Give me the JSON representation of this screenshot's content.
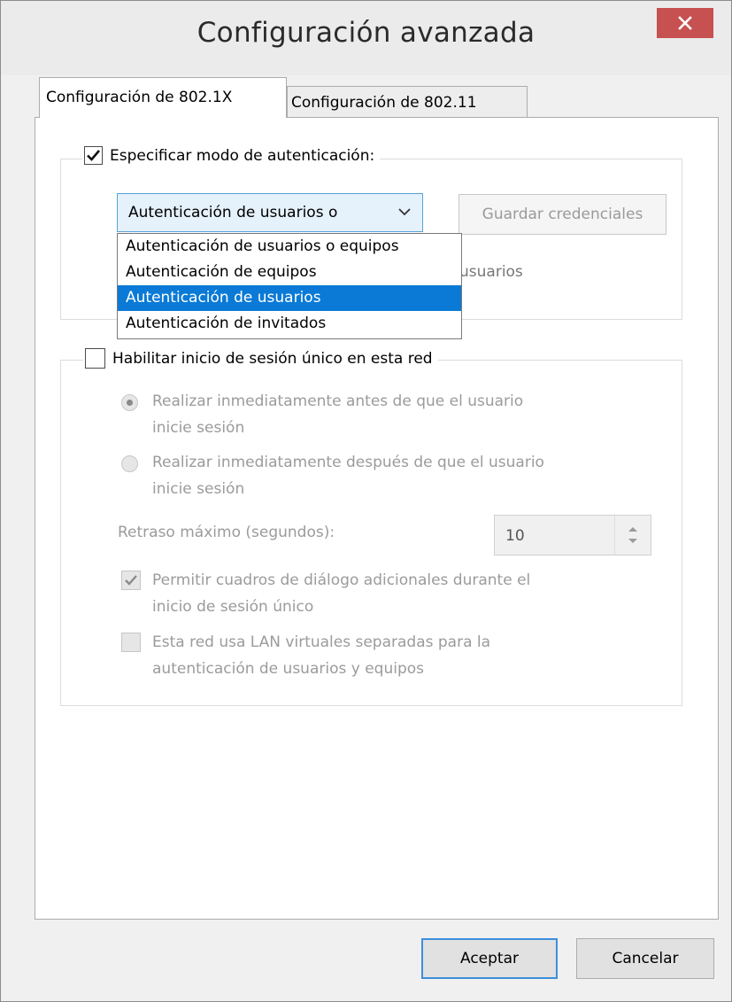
{
  "window": {
    "title": "Configuración avanzada",
    "close_label": "×"
  },
  "tabs": [
    {
      "label": "Configuración de 802.1X",
      "active": true
    },
    {
      "label": "Configuración de 802.11",
      "active": false
    }
  ],
  "auth_group": {
    "checkbox_label": "Especificar modo de autenticación:",
    "checked": true,
    "combo_value": "Autenticación de usuarios o",
    "save_credentials_label": "Guardar credenciales",
    "dropdown_options": [
      "Autenticación de usuarios o equipos",
      "Autenticación de equipos",
      "Autenticación de usuarios",
      "Autenticación de invitados"
    ],
    "selected_option_index": 2,
    "partially_hidden_text": "usuarios"
  },
  "sso_group": {
    "checkbox_label": "Habilitar inicio de sesión único en esta red",
    "checked": false,
    "radio_before": {
      "line1": "Realizar inmediatamente antes de que el usuario",
      "line2": "inicie sesión",
      "selected": true
    },
    "radio_after": {
      "line1": "Realizar inmediatamente después de que el usuario",
      "line2": "inicie sesión",
      "selected": false
    },
    "max_delay_label": "Retraso máximo (segundos):",
    "max_delay_value": "10",
    "allow_dialogs": {
      "line1": "Permitir cuadros de diálogo adicionales durante el",
      "line2": "inicio de sesión único",
      "checked": true
    },
    "vlan": {
      "line1": "Esta red usa LAN virtuales separadas para la",
      "line2": "autenticación de usuarios y equipos",
      "checked": false
    }
  },
  "buttons": {
    "ok": "Aceptar",
    "cancel": "Cancelar"
  },
  "colors": {
    "close_button": "#c75050",
    "selection": "#0a7ad6",
    "default_button_border": "#3c8fdc"
  }
}
